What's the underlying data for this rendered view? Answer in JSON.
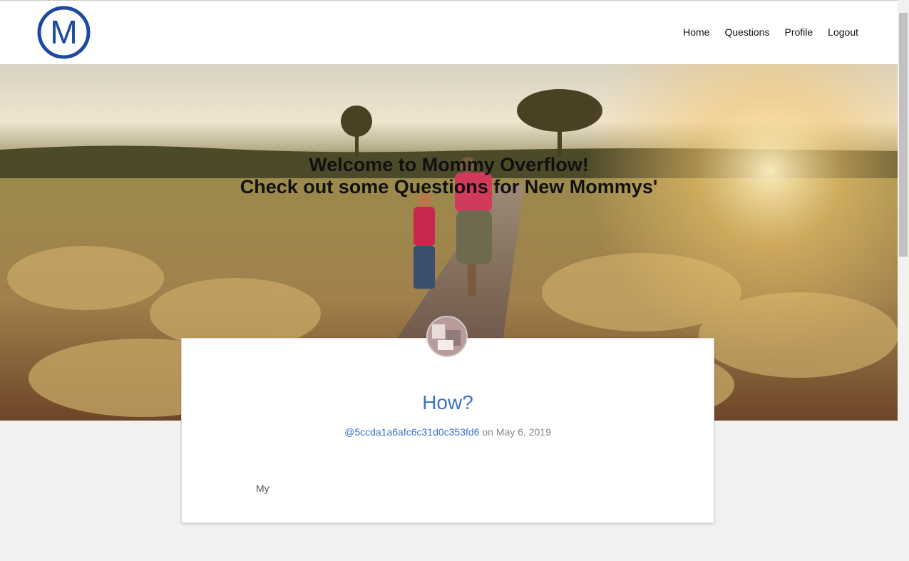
{
  "nav": {
    "logo_letter": "M",
    "links": [
      "Home",
      "Questions",
      "Profile",
      "Logout"
    ]
  },
  "hero": {
    "line1": "Welcome to Mommy Overflow!",
    "line2": "Check out some Questions for New Mommys'"
  },
  "question": {
    "title": "How?",
    "author": "@5ccda1a6afc6c31d0c353fd6",
    "date_text": "on May 6, 2019",
    "body": "My"
  },
  "colors": {
    "logo_blue": "#1b4aa0",
    "link_blue": "#3d73c8",
    "meta_gray": "#888888",
    "page_bg": "#f1f1f2"
  }
}
